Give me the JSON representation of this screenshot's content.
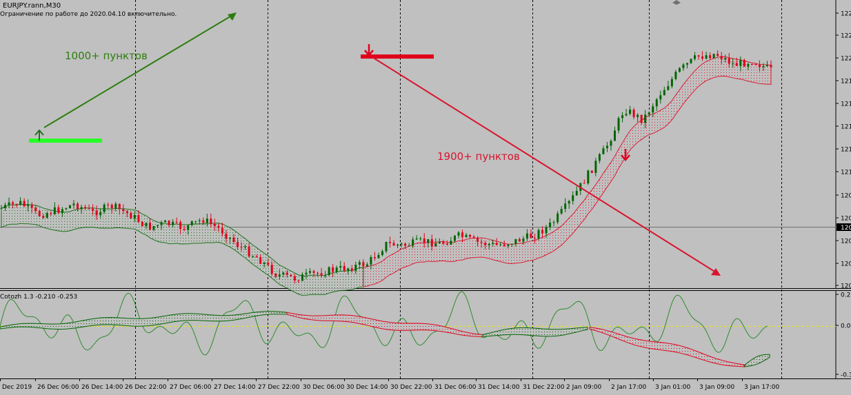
{
  "header": {
    "symbol_line": "EURJPY.rann,M30",
    "notice_line": "Ограничение по работе до 2020.04.10 включительно."
  },
  "oscillator": {
    "label": "Cotozh 1.3 -0.210 -0.253"
  },
  "annotations": {
    "up_text": "1000+ пунктов",
    "down_text": "1900+ пунктов"
  },
  "colors": {
    "background": "#c0c0c0",
    "bull_cloud": "#006400",
    "bear_cloud": "#e0001b",
    "up_arrow": "#2e7d10",
    "down_arrow": "#d9142e",
    "signal_bar": "#26ff26",
    "oscillator_line": "#2e8b2e",
    "zero_line": "#e6e600"
  },
  "chart_data": [
    {
      "type": "candlestick",
      "symbol": "EURJPY",
      "timeframe": "M30",
      "x_tick_labels": [
        "Dec 2019",
        "26 Dec 06:00",
        "26 Dec 14:00",
        "26 Dec 22:00",
        "27 Dec 06:00",
        "27 Dec 14:00",
        "27 Dec 22:00",
        "30 Dec 06:00",
        "30 Dec 14:00",
        "30 Dec 22:00",
        "31 Dec 06:00",
        "31 Dec 14:00",
        "31 Dec 22:00",
        "2 Jan 09:00",
        "2 Jan 17:00",
        "3 Jan 01:00",
        "3 Jan 09:00",
        "3 Jan 17:00"
      ],
      "y_tick_labels": [
        "122",
        "122",
        "122",
        "121",
        "121",
        "121",
        "121",
        "121",
        "120",
        "120",
        "120",
        "120",
        "120",
        "120"
      ],
      "current_price_label": "120",
      "annotations": [
        "1000+ пунктов",
        "1900+ пунктов"
      ],
      "price_path": [
        0.72,
        0.7,
        0.745,
        0.728,
        0.705,
        0.736,
        0.712,
        0.742,
        0.79,
        0.775,
        0.792,
        0.76,
        0.8,
        0.86,
        0.9,
        0.96,
        0.975,
        0.96,
        0.945,
        0.935,
        0.92,
        0.85,
        0.855,
        0.84,
        0.848,
        0.82,
        0.845,
        0.855,
        0.84,
        0.82,
        0.78,
        0.7,
        0.6,
        0.5,
        0.36,
        0.4,
        0.3,
        0.22,
        0.17,
        0.16,
        0.2,
        0.185,
        0.22
      ]
    },
    {
      "type": "line",
      "name": "Cotozh 1.3",
      "values_shown": [
        -0.21,
        -0.253
      ],
      "y_tick_labels": [
        "0.2",
        "0.0",
        "-0.3"
      ],
      "ylim": [
        -0.3,
        0.2
      ]
    }
  ]
}
